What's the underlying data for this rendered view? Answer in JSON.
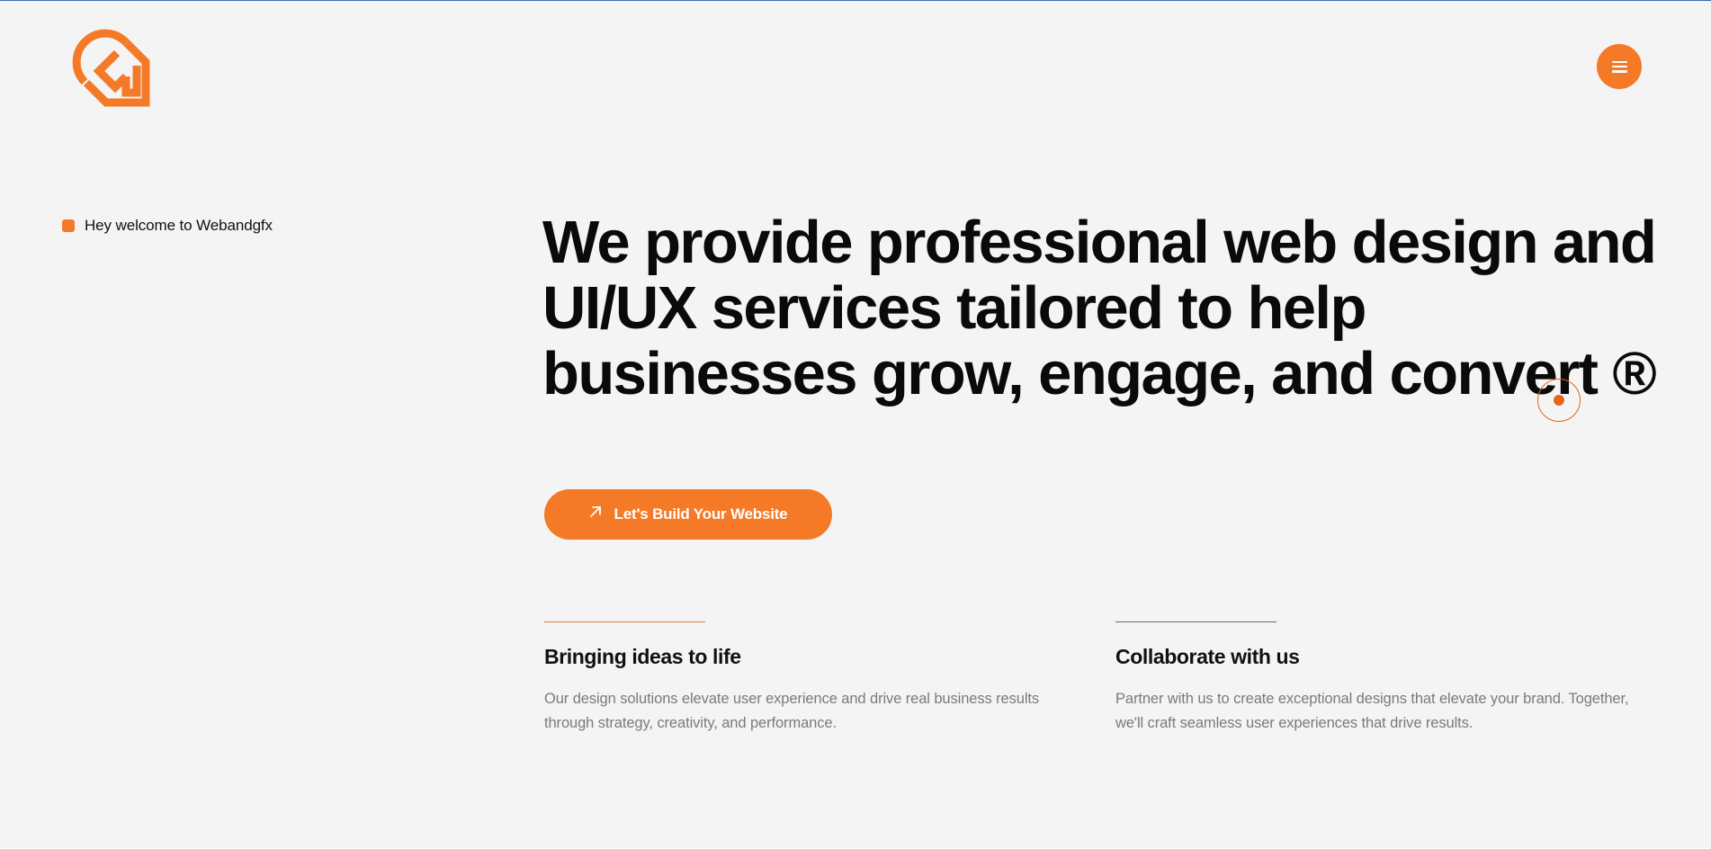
{
  "brand": {
    "logo_icon": "webandgfx-logo-icon",
    "accent_color": "#f47a28"
  },
  "header": {
    "menu_icon": "hamburger-menu-icon"
  },
  "hero": {
    "welcome_text": "Hey welcome to Webandgfx",
    "headline": "We provide professional web design and UI/UX services tailored to help businesses grow, engage, and convert ®",
    "cta_label": "Let's Build Your Website",
    "cta_icon": "arrow-up-right-icon"
  },
  "features": [
    {
      "title": "Bringing ideas to life",
      "description": "Our design solutions elevate user experience and drive real business results through strategy, creativity, and performance.",
      "rule_color": "#f47a28"
    },
    {
      "title": "Collaborate with us",
      "description": "Partner with us to create exceptional designs that elevate your brand. Together, we'll craft seamless user experiences that drive results.",
      "rule_color": "#6b6b6b"
    }
  ]
}
